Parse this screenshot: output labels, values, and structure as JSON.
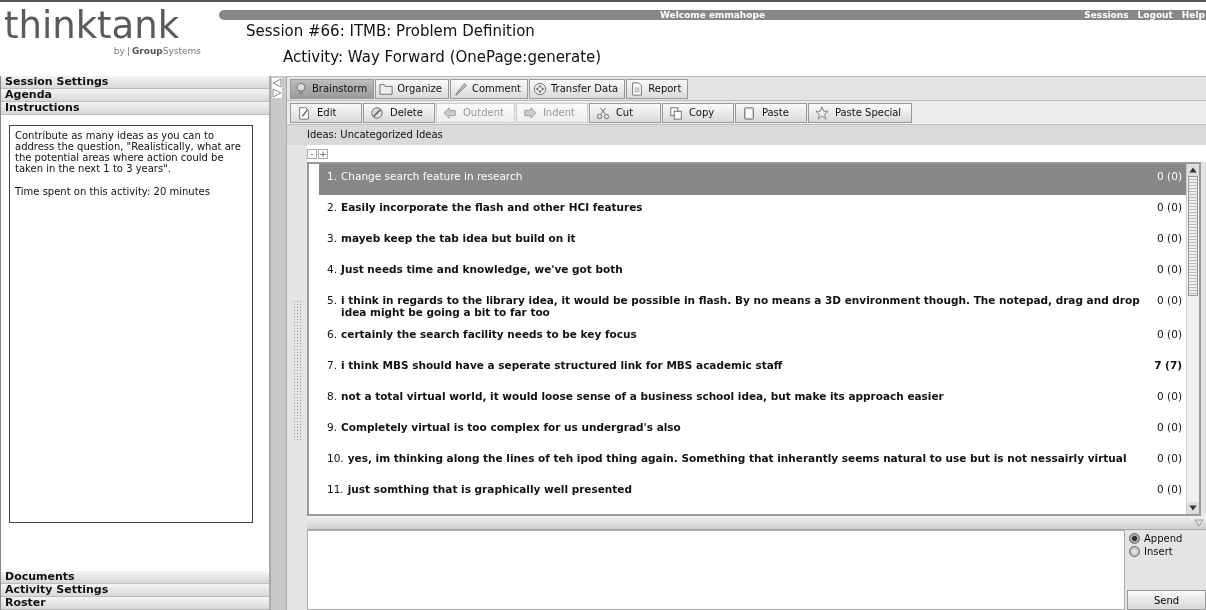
{
  "logo": {
    "wordmark": "thinktank",
    "byline_prefix": "by",
    "byline_brand": "**Group**Systems"
  },
  "header": {
    "welcome": "Welcome emmahope",
    "links": [
      "Sessions",
      "Logout",
      "Help"
    ],
    "session_title": "Session #66: ITMB: Problem Definition",
    "activity_title": "Activity: Way Forward (OnePage:generate)"
  },
  "sidebar": {
    "sections": [
      {
        "label": "Session Settings"
      },
      {
        "label": "Agenda"
      },
      {
        "label": "Instructions",
        "paragraphs": [
          "Contribute as many ideas as you can to address the question, \"Realistically, what are the potential areas where action could be taken in the next 1 to 3 years\".",
          "Time spent on this activity: 20 minutes"
        ]
      },
      {
        "label": "Documents"
      },
      {
        "label": "Activity Settings"
      },
      {
        "label": "Roster"
      }
    ]
  },
  "tabs": [
    {
      "label": "Brainstorm",
      "kind": "bulb",
      "selected": true
    },
    {
      "label": "Organize",
      "kind": "folder",
      "selected": false
    },
    {
      "label": "Comment",
      "kind": "pencil",
      "selected": false
    },
    {
      "label": "Transfer Data",
      "kind": "arrows",
      "selected": false
    },
    {
      "label": "Report",
      "kind": "document",
      "selected": false
    }
  ],
  "toolbar": [
    {
      "label": "Edit",
      "kind": "edit",
      "disabled": false
    },
    {
      "label": "Delete",
      "kind": "delete",
      "disabled": false
    },
    {
      "label": "Outdent",
      "kind": "left",
      "disabled": true
    },
    {
      "label": "Indent",
      "kind": "right",
      "disabled": true
    },
    {
      "label": "Cut",
      "kind": "scissors",
      "disabled": false
    },
    {
      "label": "Copy",
      "kind": "copy",
      "disabled": false
    },
    {
      "label": "Paste",
      "kind": "clipboard",
      "disabled": false
    },
    {
      "label": "Paste Special",
      "kind": "star",
      "disabled": false
    }
  ],
  "ideas": {
    "heading": "Ideas: Uncategorized Ideas",
    "outline_controls": [
      "-",
      "+"
    ],
    "items": [
      {
        "number": "1.",
        "text": "Change search feature in research",
        "score": "0 (0)",
        "selected": true,
        "score_bold": false
      },
      {
        "number": "2.",
        "text": "Easily incorporate the flash and other HCI features",
        "score": "0 (0)",
        "selected": false,
        "score_bold": false
      },
      {
        "number": "3.",
        "text": "mayeb keep the tab idea but build on it",
        "score": "0 (0)",
        "selected": false,
        "score_bold": false
      },
      {
        "number": "4.",
        "text": "Just needs time and knowledge, we've got both",
        "score": "0 (0)",
        "selected": false,
        "score_bold": false
      },
      {
        "number": "5.",
        "text": "i think in regards to the library idea, it would be possible in flash. By no means a 3D environment though. The notepad, drag and drop idea might be going a bit to far too",
        "score": "0 (0)",
        "selected": false,
        "score_bold": false
      },
      {
        "number": "6.",
        "text": "certainly the search facility needs to be key focus",
        "score": "0 (0)",
        "selected": false,
        "score_bold": false
      },
      {
        "number": "7.",
        "text": "i think MBS should have a seperate structured link for MBS academic staff",
        "score": "7 (7)",
        "selected": false,
        "score_bold": true
      },
      {
        "number": "8.",
        "text": "not a total virtual world, it would loose sense of a business school idea, but make its approach easier",
        "score": "0 (0)",
        "selected": false,
        "score_bold": false
      },
      {
        "number": "9.",
        "text": "Completely virtual is too complex for us undergrad's also",
        "score": "0 (0)",
        "selected": false,
        "score_bold": false
      },
      {
        "number": "10.",
        "text": "yes, im thinking along the lines of teh ipod thing again. Something that inherantly seems natural to use but is not nessairly virtual",
        "score": "0 (0)",
        "selected": false,
        "score_bold": false
      },
      {
        "number": "11.",
        "text": "just somthing that is graphically well presented",
        "score": "0 (0)",
        "selected": false,
        "score_bold": false
      }
    ]
  },
  "input": {
    "modes": [
      {
        "label": "Append",
        "selected": true
      },
      {
        "label": "Insert",
        "selected": false
      }
    ],
    "send": "Send"
  }
}
